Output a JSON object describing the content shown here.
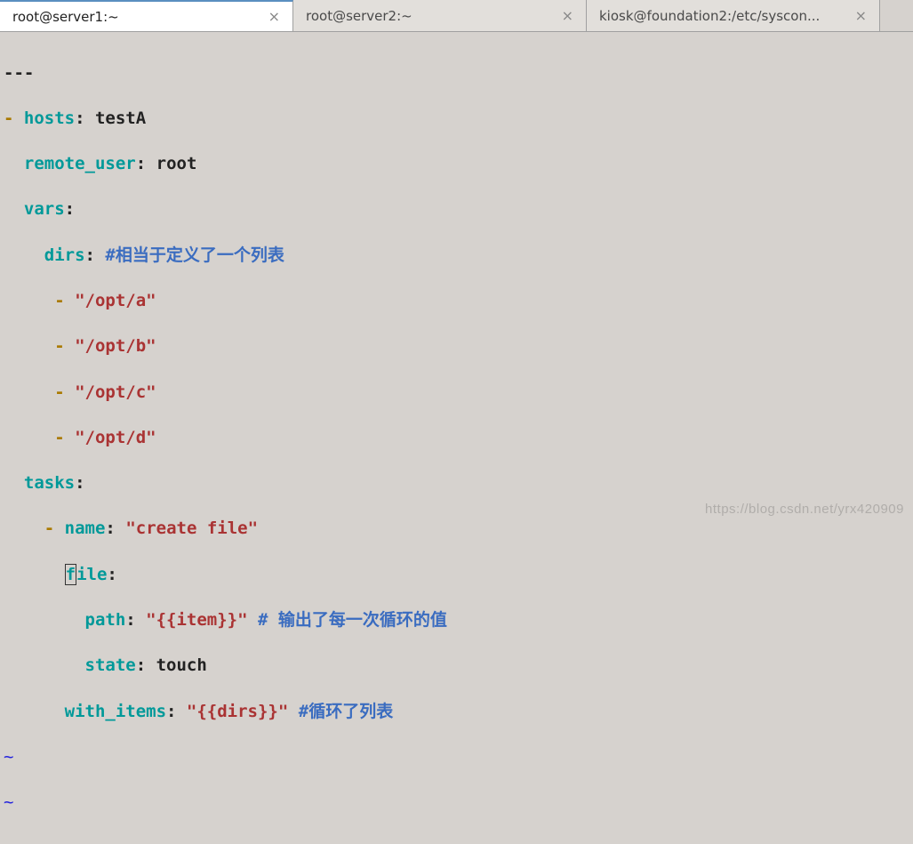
{
  "tabs": [
    {
      "label": "root@server1:~",
      "active": true
    },
    {
      "label": "root@server2:~",
      "active": false
    },
    {
      "label": "kiosk@foundation2:/etc/syscon...",
      "active": false
    }
  ],
  "yaml": {
    "doc_start": "---",
    "hosts_key": "hosts",
    "hosts_val": "testA",
    "remote_user_key": "remote_user",
    "remote_user_val": "root",
    "vars_key": "vars",
    "dirs_key": "dirs",
    "dirs_comment": "#相当于定义了一个列表",
    "dirs": [
      "\"/opt/a\"",
      "\"/opt/b\"",
      "\"/opt/c\"",
      "\"/opt/d\""
    ],
    "tasks_key": "tasks",
    "name_key": "name",
    "name_val": "\"create file\"",
    "file_key_prefix": "f",
    "file_key_rest": "ile",
    "path_key": "path",
    "path_val": "\"{{item}}\"",
    "path_comment": "# 输出了每一次循环的值",
    "state_key": "state",
    "state_val": "touch",
    "with_items_key": "with_items",
    "with_items_val": "\"{{dirs}}\"",
    "with_items_comment": "#循环了列表"
  },
  "tilde": "~",
  "watermark": "https://blog.csdn.net/yrx420909"
}
